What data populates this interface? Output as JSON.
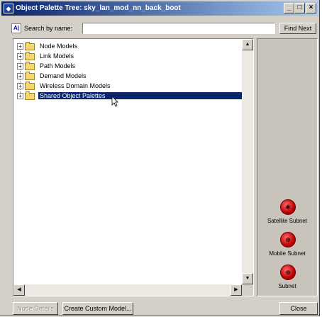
{
  "window": {
    "title": "Object Palette Tree: sky_lan_mod_nn_back_boot",
    "controls": [
      "_",
      "□",
      "×"
    ]
  },
  "search": {
    "label": "Search by name:",
    "value": "",
    "find_next": "Find Next"
  },
  "tree": {
    "items": [
      {
        "label": "Node Models",
        "selected": false
      },
      {
        "label": "Link Models",
        "selected": false
      },
      {
        "label": "Path Models",
        "selected": false
      },
      {
        "label": "Demand Models",
        "selected": false
      },
      {
        "label": "Wireless Domain Models",
        "selected": false
      },
      {
        "label": "Shared Object Palettes",
        "selected": true
      }
    ]
  },
  "palette": {
    "items": [
      {
        "label": "Satellite Subnet",
        "icon": "satellite-subnet-icon"
      },
      {
        "label": "Mobile Subnet",
        "icon": "mobile-subnet-icon"
      },
      {
        "label": "Subnet",
        "icon": "subnet-icon"
      }
    ]
  },
  "buttons": {
    "node_details": "Node Details",
    "create_custom_model": "Create Custom Model...",
    "close": "Close"
  },
  "colors": {
    "selection": "#0a246a",
    "face": "#d4d0c8",
    "subnet_red": "#c00000"
  }
}
